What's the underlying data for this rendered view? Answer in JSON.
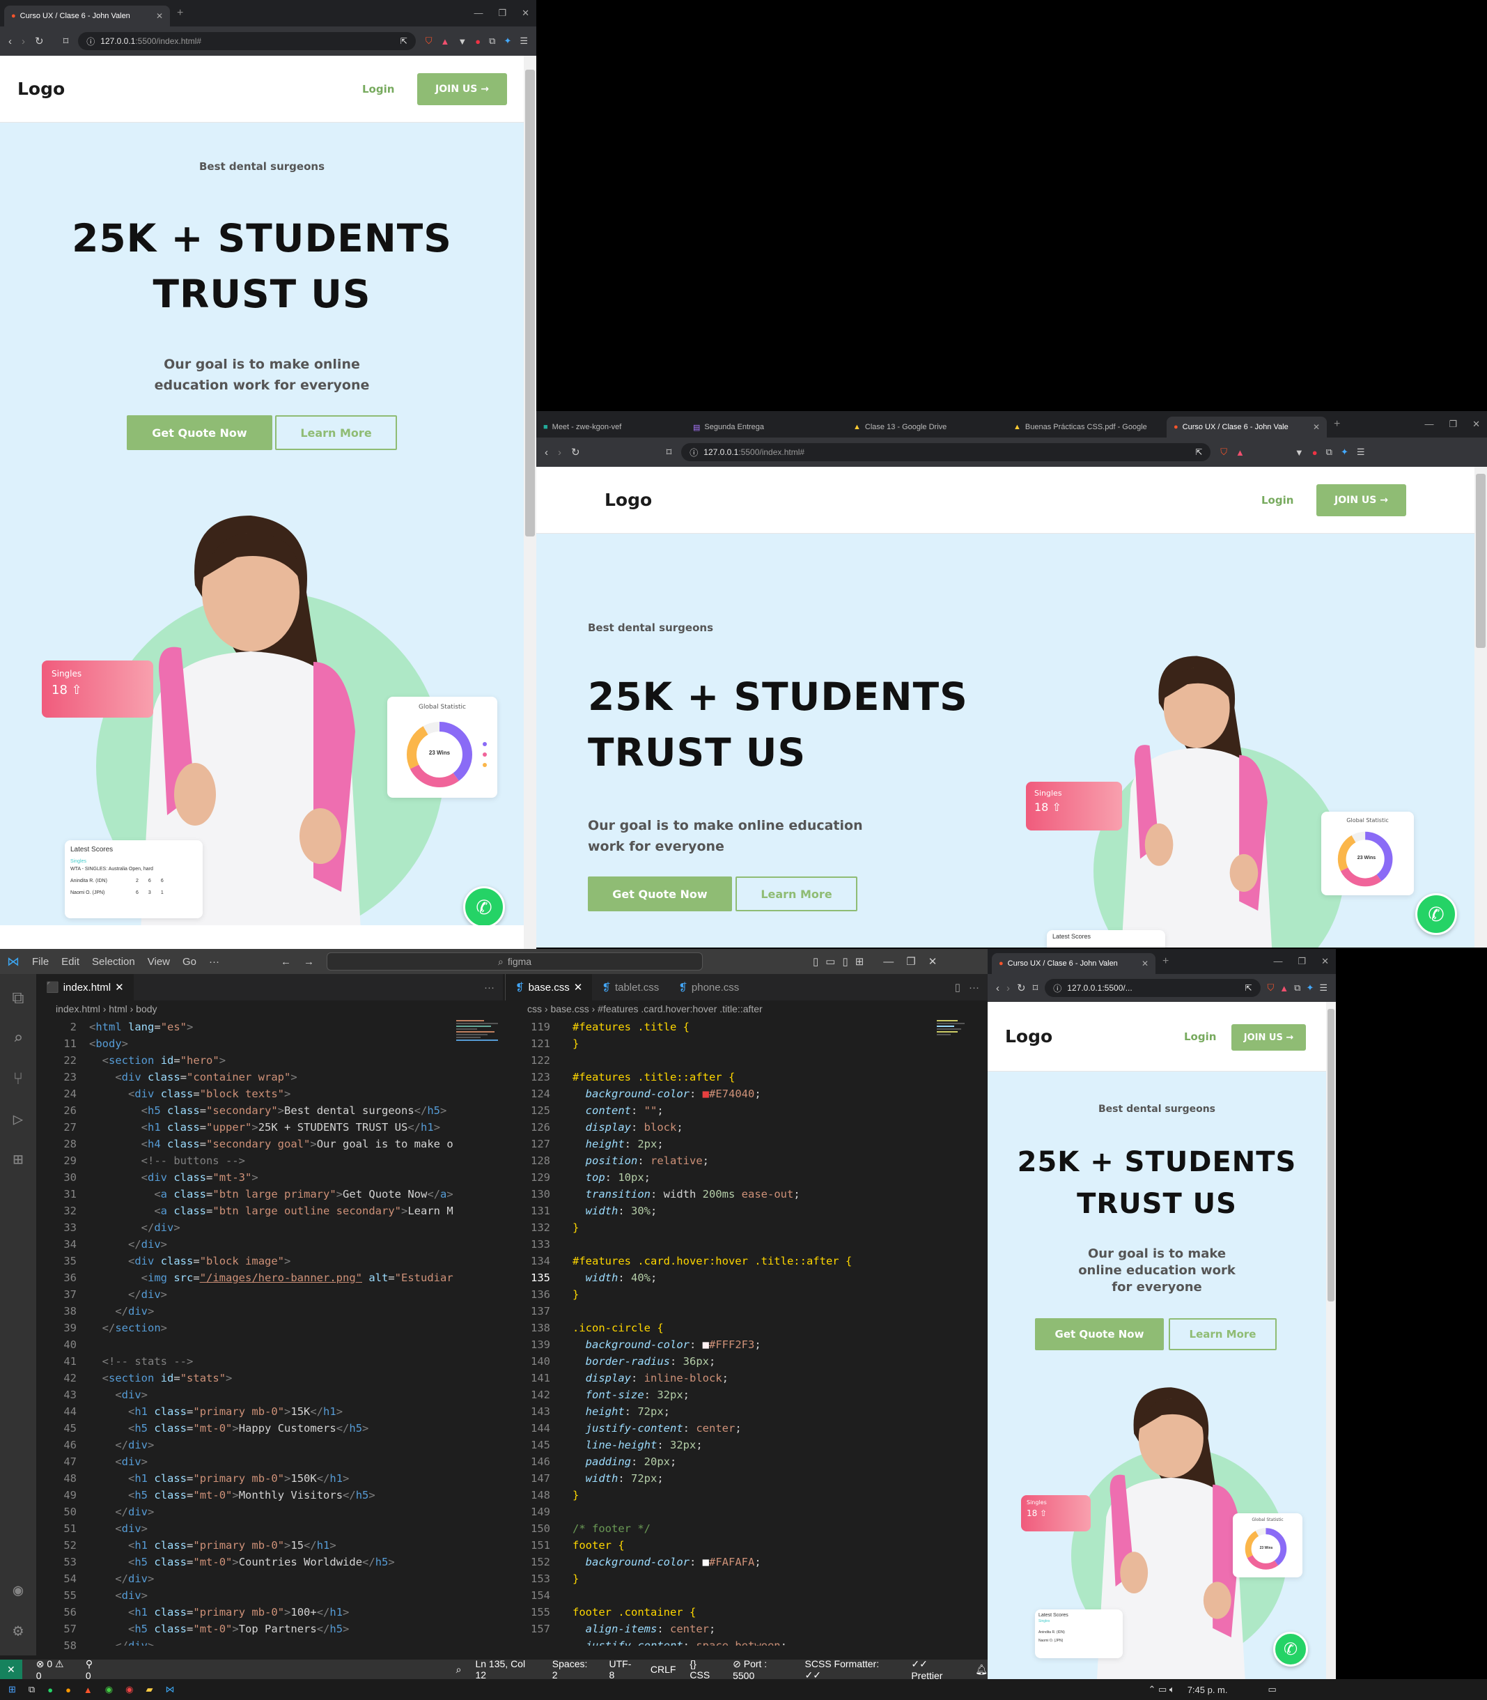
{
  "colors": {
    "accent": "#8fbc74",
    "hero_bg": "#ddf1fc",
    "singles_pink": "#f05b7c",
    "whatsapp": "#25d366",
    "vscode_status": "#007acc"
  },
  "browser1": {
    "tab_title": "Curso UX / Clase 6 - John Valen",
    "url_host": "127.0.0.1",
    "url_path": ":5500/index.html#"
  },
  "browser2": {
    "tabs": [
      "Meet - zwe-kgon-vef",
      "Segunda Entrega",
      "Clase 13 - Google Drive",
      "Buenas Prácticas CSS.pdf - Google",
      "Curso UX / Clase 6 - John Vale"
    ],
    "url_host": "127.0.0.1",
    "url_path": ":5500/index.html#"
  },
  "browser3": {
    "tab_title": "Curso UX / Clase 6 - John Valen",
    "url": "127.0.0.1:5500/..."
  },
  "site": {
    "logo": "Logo",
    "login": "Login",
    "join": "JOIN US →",
    "kicker": "Best dental surgeons",
    "h1_line1": "25K + STUDENTS",
    "h1_line2": "TRUST US",
    "goal": "Our goal is to make online education work for everyone",
    "goal_a": "Our goal is to make online",
    "goal_b": "education work for everyone",
    "goal2_a": "Our goal is to make online education",
    "goal2_b": "work for everyone",
    "goal3_a": "Our goal is to make",
    "goal3_b": "online education work",
    "goal3_c": "for everyone",
    "btn_quote": "Get Quote Now",
    "btn_learn": "Learn More",
    "card_singles_label": "Singles",
    "card_singles_value": "18",
    "card_stat_title": "Global Statistic",
    "card_stat_center": "23 Wins",
    "scores_title": "Latest Scores",
    "scores_tabs": "Singles",
    "scores_event": "WTA - SINGLES: Australia Open, hard",
    "scores_rows": [
      [
        "Anindita R. (IDN)",
        "2",
        "6",
        "6"
      ],
      [
        "Naomi O. (JPN)",
        "6",
        "3",
        "1"
      ]
    ]
  },
  "vscode": {
    "menu": [
      "File",
      "Edit",
      "Selection",
      "View",
      "Go",
      "···"
    ],
    "search": "figma",
    "left_tab": "index.html",
    "left_crumb": [
      "index.html",
      "html",
      "body"
    ],
    "right_tabs": [
      "base.css",
      "tablet.css",
      "phone.css"
    ],
    "right_crumb": [
      "css",
      "base.css",
      "#features .card.hover:hover .title::after"
    ],
    "status": {
      "errors": "0",
      "warnings": "0",
      "ports": "0",
      "pos": "Ln 135, Col 12",
      "spaces": "Spaces: 2",
      "enc": "UTF-8",
      "eol": "CRLF",
      "lang": "CSS",
      "port": "Port : 5500",
      "scss": "SCSS Formatter: ✓✓",
      "prettier": "Prettier"
    }
  },
  "taskbar": {
    "time": "7:45 p. m."
  }
}
